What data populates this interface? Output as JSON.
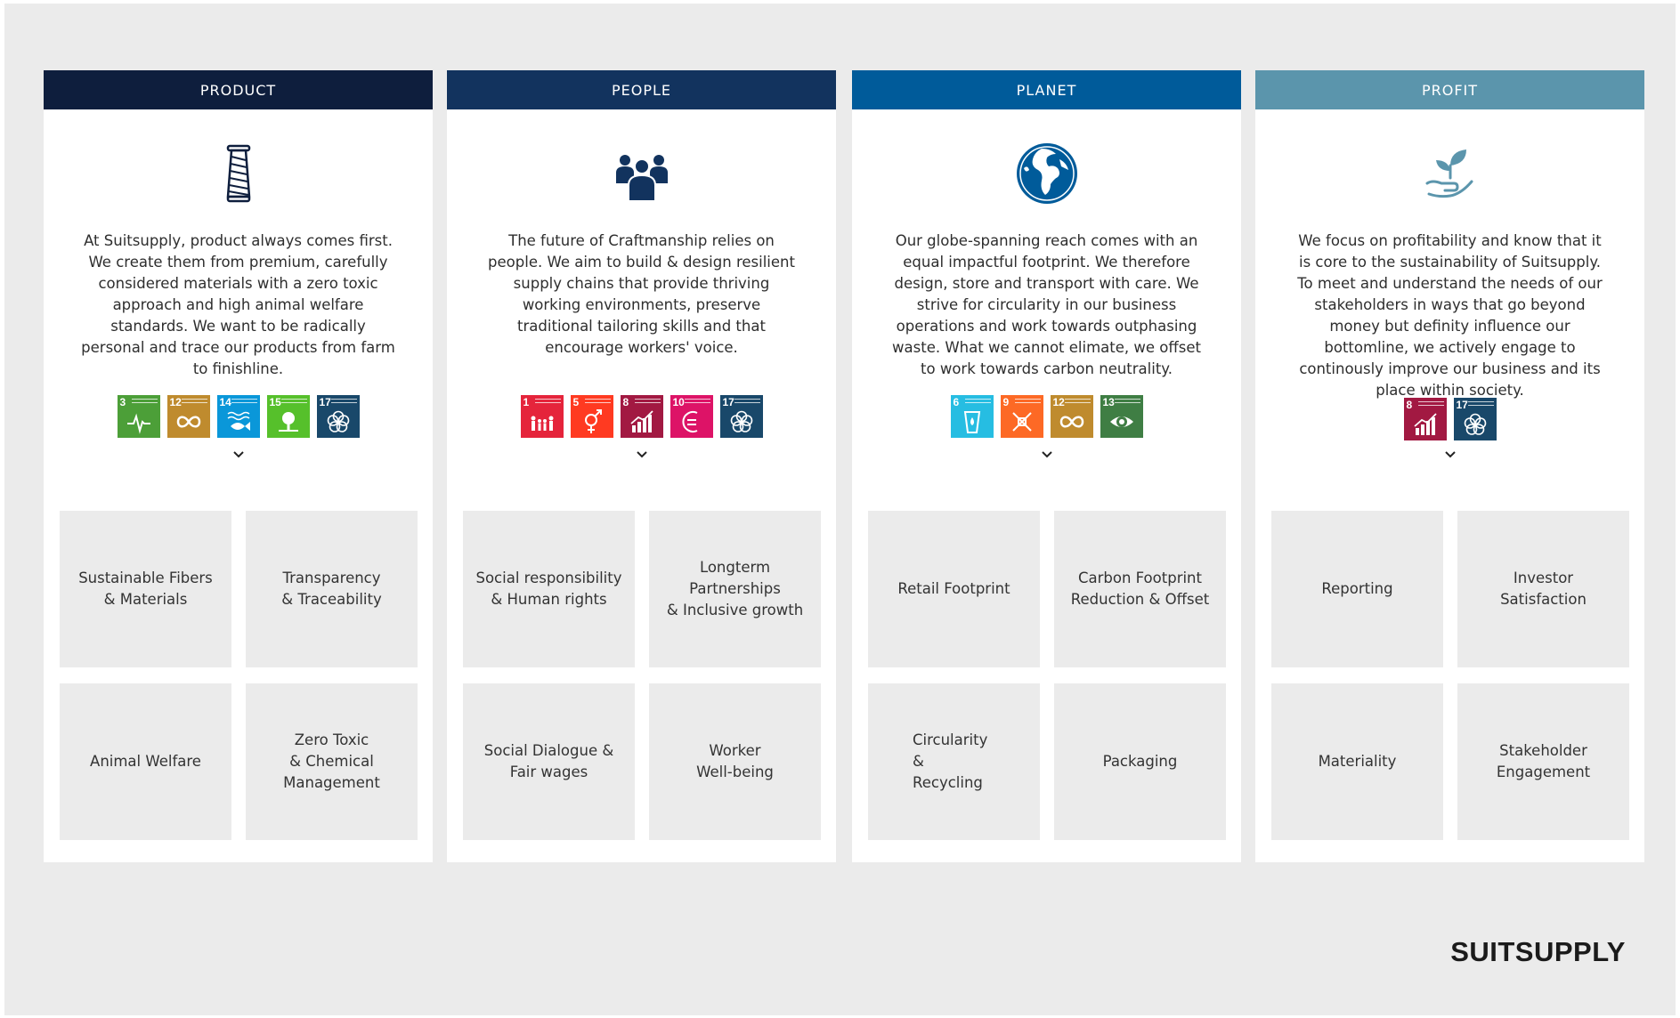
{
  "brand": "SUITSUPPLY",
  "columns": [
    {
      "title": "PRODUCT",
      "header_color": "#0e1e3d",
      "icon": "thread-spool-icon",
      "icon_color": "#0e1e3d",
      "description": "At Suitsupply, product always comes first. We create them from premium, carefully considered materials with a zero toxic approach and high animal welfare standards. We want to be radically personal and trace our products from farm to finishline.",
      "sdg_goals": [
        {
          "number": "3",
          "color": "#4c9f38",
          "icon": "health-pulse-icon"
        },
        {
          "number": "12",
          "color": "#bf8b2e",
          "icon": "infinity-icon"
        },
        {
          "number": "14",
          "color": "#0a97d9",
          "icon": "fish-icon"
        },
        {
          "number": "15",
          "color": "#56c02b",
          "icon": "tree-icon"
        },
        {
          "number": "17",
          "color": "#19486a",
          "icon": "flower-rings-icon"
        }
      ],
      "tiles": [
        "Sustainable Fibers\n& Materials",
        "Transparency\n& Traceability",
        "Animal Welfare",
        "Zero Toxic\n&    Chemical\nManagement"
      ]
    },
    {
      "title": "PEOPLE",
      "header_color": "#12335e",
      "icon": "people-group-icon",
      "icon_color": "#12335e",
      "description": "The future of Craftmanship relies on people. We aim to build & design resilient supply chains that provide thriving working environments, preserve traditional tailoring skills and that encourage workers' voice.",
      "sdg_goals": [
        {
          "number": "1",
          "color": "#e5243b",
          "icon": "family-icon"
        },
        {
          "number": "5",
          "color": "#ff3a21",
          "icon": "gender-equality-icon"
        },
        {
          "number": "8",
          "color": "#a21942",
          "icon": "growth-chart-icon"
        },
        {
          "number": "10",
          "color": "#dd1367",
          "icon": "equality-icon"
        },
        {
          "number": "17",
          "color": "#19486a",
          "icon": "flower-rings-icon"
        }
      ],
      "tiles": [
        "Social responsibility\n& Human rights",
        "Longterm Partnerships\n& Inclusive growth",
        "Social Dialogue &\nFair wages",
        "Worker\nWell-being"
      ]
    },
    {
      "title": "PLANET",
      "header_color": "#005b9a",
      "icon": "globe-icon",
      "icon_color": "#005b9a",
      "description": "Our globe-spanning reach comes with an equal impactful footprint. We therefore design, store and transport with care. We strive for circularity in our business operations and work towards outphasing waste. What we cannot elimate, we offset to work towards carbon neutrality.",
      "sdg_goals": [
        {
          "number": "6",
          "color": "#26bde2",
          "icon": "water-glass-icon"
        },
        {
          "number": "9",
          "color": "#fd6925",
          "icon": "innovation-cubes-icon"
        },
        {
          "number": "12",
          "color": "#bf8b2e",
          "icon": "infinity-icon"
        },
        {
          "number": "13",
          "color": "#3f7e44",
          "icon": "eye-globe-icon"
        }
      ],
      "tiles": [
        "Retail Footprint",
        "Carbon    Footprint\nReduction & Offset",
        "Circularity\n&\nRecycling",
        "Packaging"
      ]
    },
    {
      "title": "PROFIT",
      "header_color": "#5b95ac",
      "icon": "hand-plant-icon",
      "icon_color": "#5b95ac",
      "description": "We focus on profitability and know that it is core to the sustainability of Suitsupply. To meet and understand the needs of our stakeholders in ways that go beyond money but definity influence our bottomline, we actively engage to continously improve our business and its place within society.",
      "sdg_goals": [
        {
          "number": "8",
          "color": "#a21942",
          "icon": "growth-chart-icon"
        },
        {
          "number": "17",
          "color": "#19486a",
          "icon": "flower-rings-icon"
        }
      ],
      "tiles": [
        "Reporting",
        "Investor\nSatisfaction",
        "Materiality",
        "Stakeholder\nEngagement"
      ]
    }
  ]
}
